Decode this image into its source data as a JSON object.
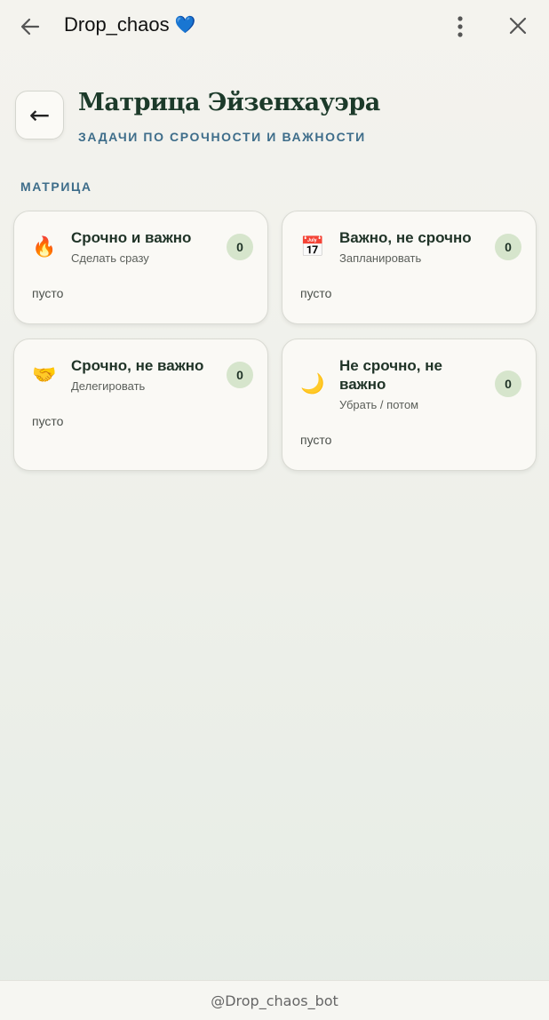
{
  "topbar": {
    "title": "Drop_chaos",
    "title_emoji": "💙",
    "back_icon": "arrow-left-icon",
    "menu_icon": "more-vertical-icon",
    "close_icon": "close-icon"
  },
  "header": {
    "back_label": "←",
    "title": "Матрица Эйзенхауэра",
    "subtitle": "ЗАДАЧИ ПО СРОЧНОСТИ И ВАЖНОСТИ"
  },
  "section": {
    "label": "МАТРИЦА"
  },
  "quadrants": [
    {
      "icon": "🔥",
      "icon_name": "fire-icon",
      "title": "Срочно и важно",
      "subtitle": "Сделать сразу",
      "count": "0",
      "empty_text": "пусто"
    },
    {
      "icon": "📅",
      "icon_name": "calendar-icon",
      "title": "Важно, не срочно",
      "subtitle": "Запланировать",
      "count": "0",
      "empty_text": "пусто"
    },
    {
      "icon": "🤝",
      "icon_name": "handshake-icon",
      "title": "Срочно, не важно",
      "subtitle": "Делегировать",
      "count": "0",
      "empty_text": "пусто"
    },
    {
      "icon": "🌙",
      "icon_name": "moon-icon",
      "title": "Не срочно, не важно",
      "subtitle": "Убрать / потом",
      "count": "0",
      "empty_text": "пусто"
    }
  ],
  "footer": {
    "bot_handle": "@Drop_chaos_bot"
  },
  "colors": {
    "accent_blue": "#3e6d8a",
    "title_green": "#1c3a2a",
    "count_badge": "#d6e5cc"
  }
}
